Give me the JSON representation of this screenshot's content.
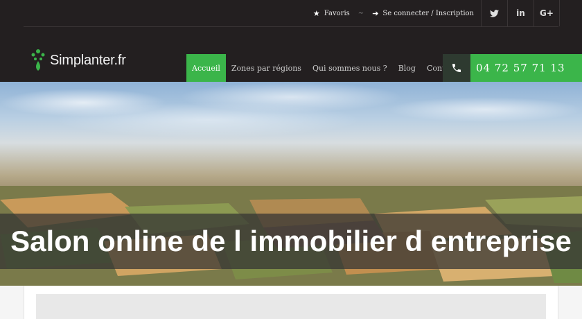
{
  "topbar": {
    "favoris_label": "Favoris",
    "separator": "~",
    "login_label": "Se connecter / Inscription",
    "social": [
      {
        "name": "twitter-icon",
        "glyph": "🐦"
      },
      {
        "name": "linkedin-icon",
        "glyph": "in"
      },
      {
        "name": "googleplus-icon",
        "glyph": "G+"
      }
    ]
  },
  "logo": {
    "text": "Simplanter.fr"
  },
  "menu": {
    "items": [
      {
        "label": "Accueil",
        "active": true
      },
      {
        "label": "Zones par régions"
      },
      {
        "label": "Qui sommes nous ?"
      },
      {
        "label": "Blog"
      },
      {
        "label": "Contact"
      }
    ]
  },
  "phone": {
    "number": "04 72 57 71 13"
  },
  "hero": {
    "title": "Salon online de l immobilier d entreprise"
  },
  "colors": {
    "accent": "#3bb54a",
    "dark": "#231f20"
  }
}
